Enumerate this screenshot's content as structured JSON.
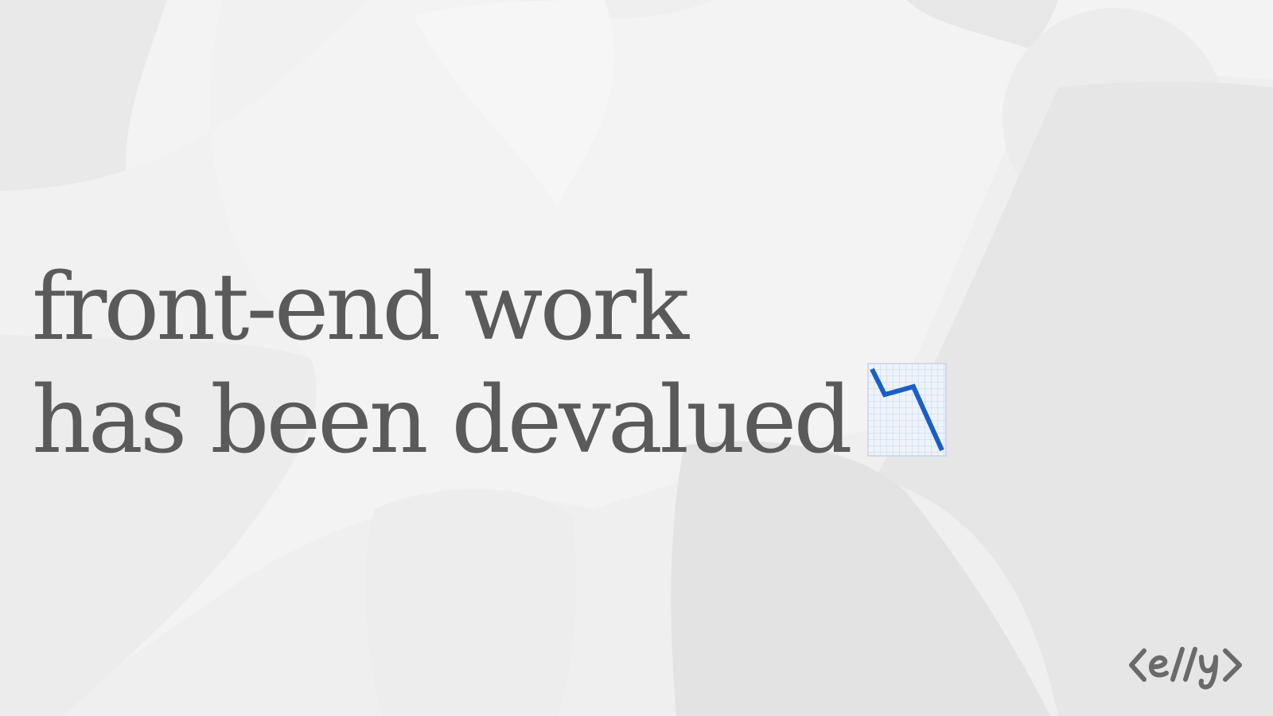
{
  "headline": {
    "line1": "front-end work",
    "line2": "has been devalued"
  },
  "icons": {
    "headline_emoji": "chart-decreasing-icon",
    "brand_logo": "elly-logo"
  },
  "logo": {
    "text": "<e//y>"
  },
  "colors": {
    "background": "#efefef",
    "headline_text": "#5a5a5a",
    "chart_line": "#1a5fc4",
    "logo": "#6a6a6a"
  }
}
